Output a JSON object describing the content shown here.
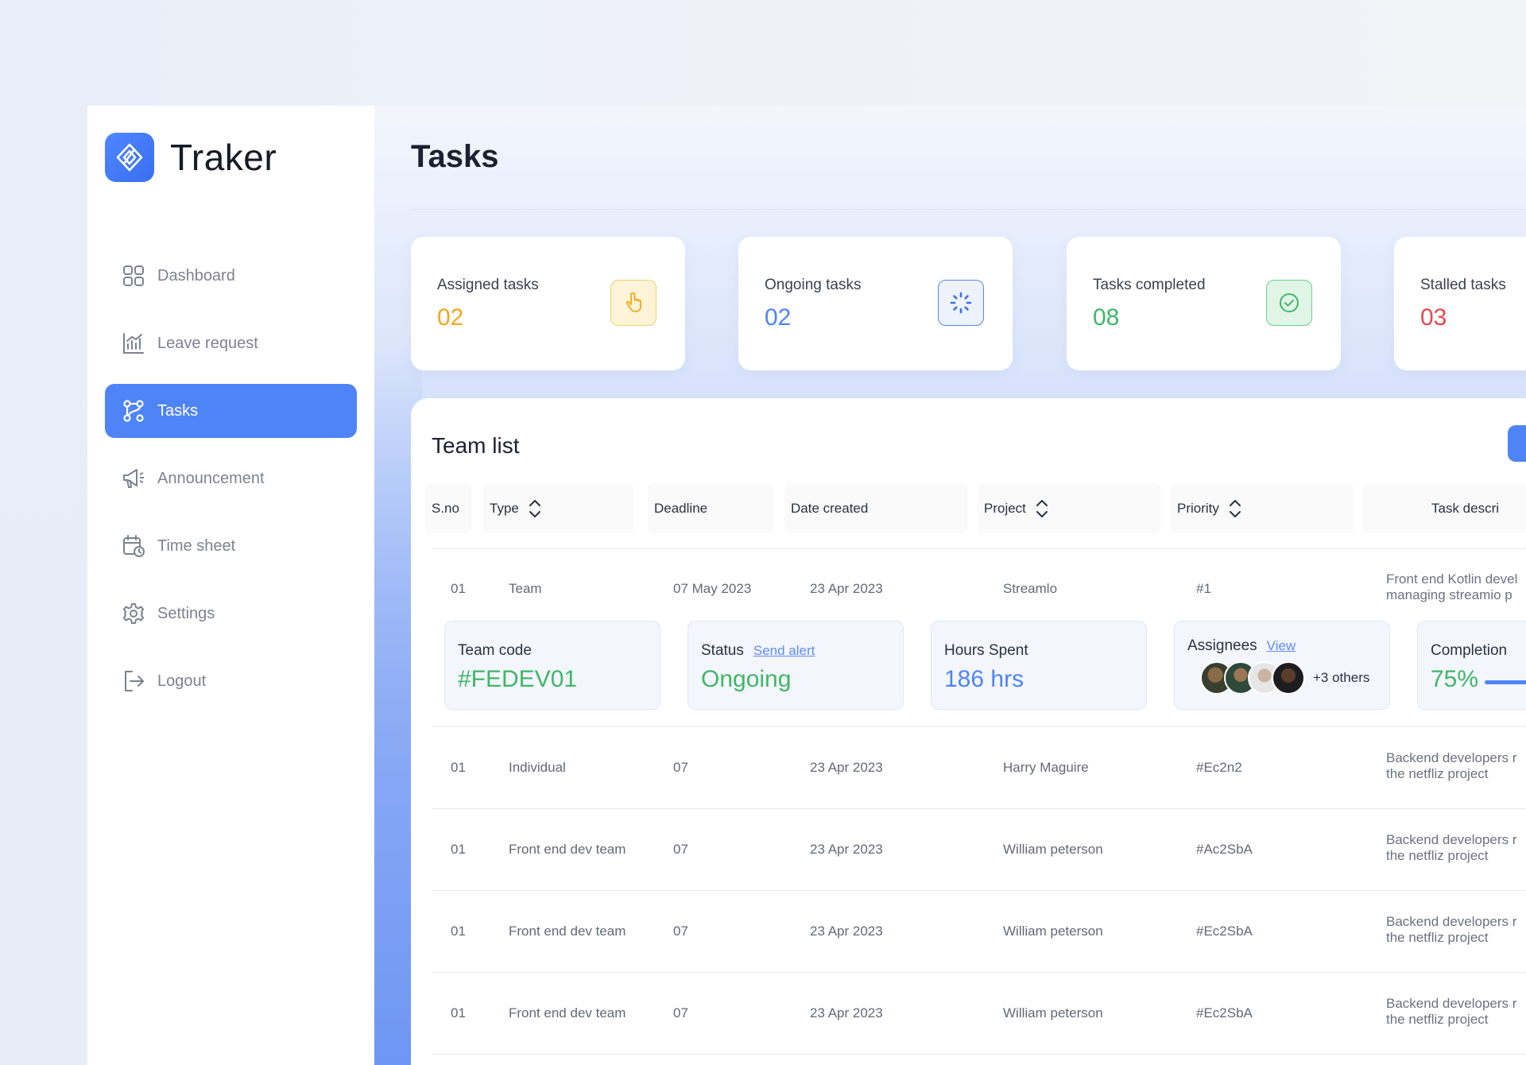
{
  "app": {
    "brand_name": "Traker",
    "accent_color": "#4f84f7"
  },
  "sidebar": {
    "items": [
      {
        "label": "Dashboard",
        "icon": "grid-icon",
        "active": false
      },
      {
        "label": "Leave request",
        "icon": "chart-icon",
        "active": false
      },
      {
        "label": "Tasks",
        "icon": "flow-icon",
        "active": true
      },
      {
        "label": "Announcement",
        "icon": "megaphone-icon",
        "active": false
      },
      {
        "label": "Time sheet",
        "icon": "calendar-clock-icon",
        "active": false
      },
      {
        "label": "Settings",
        "icon": "gear-icon",
        "active": false
      },
      {
        "label": "Logout",
        "icon": "logout-icon",
        "active": false
      }
    ]
  },
  "page": {
    "title": "Tasks"
  },
  "stats": [
    {
      "label": "Assigned tasks",
      "value": "02",
      "color": "#f2a81d",
      "icon": "hand-pointer-icon"
    },
    {
      "label": "Ongoing tasks",
      "value": "02",
      "color": "#4f84f7",
      "icon": "loading-icon"
    },
    {
      "label": "Tasks completed",
      "value": "08",
      "color": "#3fb766",
      "icon": "check-circle-icon"
    },
    {
      "label": "Stalled tasks",
      "value": "03",
      "color": "#e5484d",
      "icon": "pause-icon"
    }
  ],
  "team_list": {
    "title": "Team list",
    "columns": [
      "S.no",
      "Type",
      "Deadline",
      "Date created",
      "Project",
      "Priority",
      "Task descri"
    ],
    "rows": [
      {
        "sno": "01",
        "type": "Team",
        "deadline": "07 May 2023",
        "created": "23 Apr 2023",
        "project": "Streamlo",
        "priority": "#1",
        "desc1": "Front end Kotlin devel",
        "desc2": "managing streamio p"
      },
      {
        "sno": "01",
        "type": "Individual",
        "deadline": "07",
        "created": "23 Apr 2023",
        "project": "Harry Maguire",
        "priority": "#Ec2n2",
        "desc1": "Backend developers r",
        "desc2": "the netfliz project"
      },
      {
        "sno": "01",
        "type": "Front end dev team",
        "deadline": "07",
        "created": "23 Apr 2023",
        "project": "William peterson",
        "priority": "#Ac2SbA",
        "desc1": "Backend developers r",
        "desc2": "the netfliz project"
      },
      {
        "sno": "01",
        "type": "Front end dev team",
        "deadline": "07",
        "created": "23 Apr 2023",
        "project": "William peterson",
        "priority": "#Ec2SbA",
        "desc1": "Backend developers r",
        "desc2": "the netfliz project"
      },
      {
        "sno": "01",
        "type": "Front end dev team",
        "deadline": "07",
        "created": "23 Apr 2023",
        "project": "William peterson",
        "priority": "#Ec2SbA",
        "desc1": "Backend developers r",
        "desc2": "the netfliz project"
      }
    ],
    "detail": {
      "team_code_label": "Team code",
      "team_code_value": "#FEDEV01",
      "status_label": "Status",
      "status_link": "Send alert",
      "status_value": "Ongoing",
      "hours_label": "Hours Spent",
      "hours_value": "186 hrs",
      "assignees_label": "Assignees",
      "assignees_link": "View",
      "assignees_others": "+3 others",
      "completion_label": "Completion",
      "completion_value": "75%",
      "completion_fraction": 0.75
    }
  }
}
